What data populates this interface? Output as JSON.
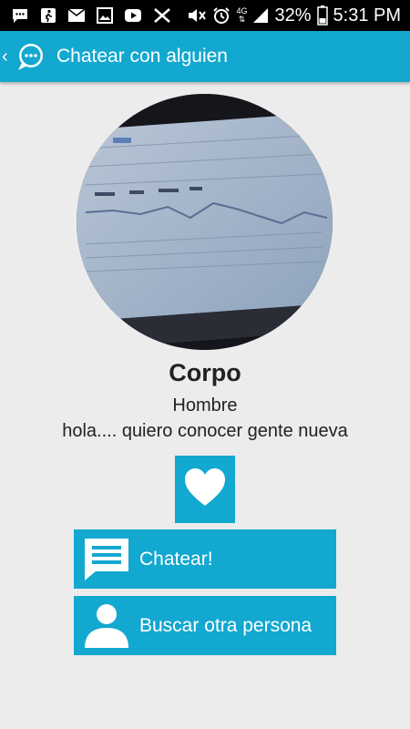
{
  "status_bar": {
    "network_label": "4G",
    "battery": "32%",
    "time": "5:31 PM",
    "left_icons": [
      "messages-icon",
      "walk-icon",
      "mail-icon",
      "image-icon",
      "youtube-icon",
      "missed-call-icon"
    ],
    "right_icons": [
      "silent-icon",
      "alarm-icon",
      "signal-icon",
      "battery-icon"
    ]
  },
  "header": {
    "title": "Chatear con alguien",
    "logo_icon": "chat-bubble-icon",
    "back_icon": "chevron-left-icon"
  },
  "profile": {
    "name": "Corpo",
    "gender": "Hombre",
    "status": "hola.... quiero conocer gente nueva",
    "photo": "profile-photo"
  },
  "actions": {
    "like_icon": "heart-icon",
    "chat": {
      "label": "Chatear!",
      "icon": "message-icon"
    },
    "search": {
      "label": "Buscar otra persona",
      "icon": "person-icon"
    }
  },
  "colors": {
    "accent": "#12a8d0",
    "background": "#ececec",
    "status_bar": "#000000",
    "text": "#222222"
  }
}
